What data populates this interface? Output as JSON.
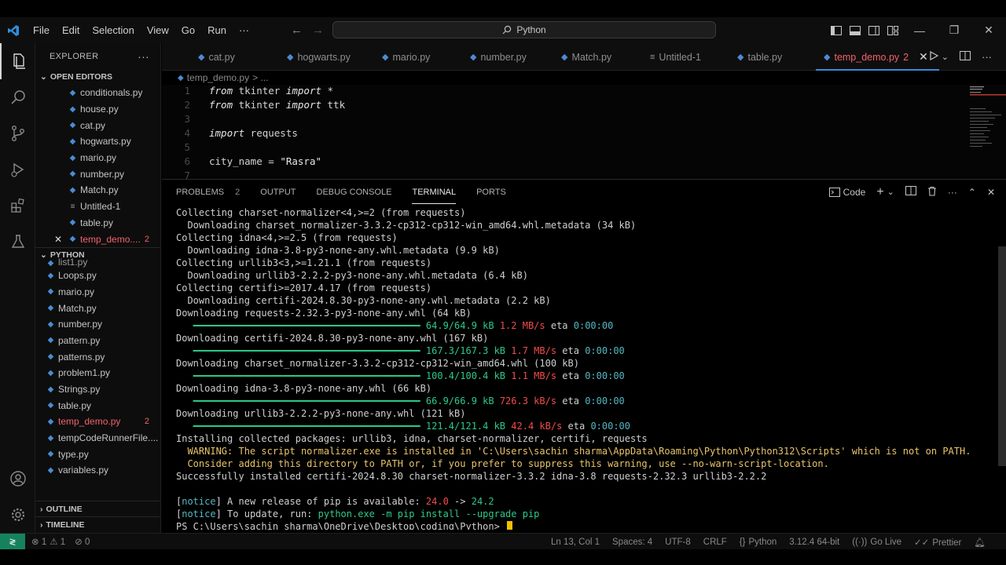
{
  "titlebar": {
    "menu": [
      "File",
      "Edit",
      "Selection",
      "View",
      "Go",
      "Run",
      "···"
    ],
    "search_text": "Python"
  },
  "explorer": {
    "title": "EXPLORER",
    "more": "···",
    "open_editors_label": "OPEN EDITORS",
    "open_editors": [
      {
        "name": "conditionals.py"
      },
      {
        "name": "house.py"
      },
      {
        "name": "cat.py"
      },
      {
        "name": "hogwarts.py"
      },
      {
        "name": "mario.py"
      },
      {
        "name": "number.py"
      },
      {
        "name": "Match.py"
      },
      {
        "name": "Untitled-1"
      },
      {
        "name": "table.py"
      },
      {
        "name": "temp_demo....",
        "badge": "2"
      }
    ],
    "folder_label": "PYTHON",
    "files": [
      {
        "name": "list1.py"
      },
      {
        "name": "Loops.py"
      },
      {
        "name": "mario.py"
      },
      {
        "name": "Match.py"
      },
      {
        "name": "number.py"
      },
      {
        "name": "pattern.py"
      },
      {
        "name": "patterns.py"
      },
      {
        "name": "problem1.py"
      },
      {
        "name": "Strings.py"
      },
      {
        "name": "table.py"
      },
      {
        "name": "temp_demo.py",
        "badge": "2"
      },
      {
        "name": "tempCodeRunnerFile...."
      },
      {
        "name": "type.py"
      },
      {
        "name": "variables.py"
      }
    ],
    "outline_label": "OUTLINE",
    "timeline_label": "TIMELINE"
  },
  "tabs": [
    {
      "label": "cat.py"
    },
    {
      "label": "hogwarts.py"
    },
    {
      "label": "mario.py"
    },
    {
      "label": "number.py"
    },
    {
      "label": "Match.py"
    },
    {
      "label": "Untitled-1"
    },
    {
      "label": "table.py"
    },
    {
      "label": "temp_demo.py",
      "badge": "2"
    }
  ],
  "breadcrumb": {
    "file": "temp_demo.py",
    "sep": "> ..."
  },
  "editor_lines": [
    {
      "n": "1",
      "parts": [
        [
          "kw",
          "from"
        ],
        [
          "",
          " tkinter "
        ],
        [
          "kw",
          "import"
        ],
        [
          "",
          " *"
        ]
      ]
    },
    {
      "n": "2",
      "parts": [
        [
          "kw",
          "from"
        ],
        [
          "",
          " tkinter "
        ],
        [
          "kw",
          "import"
        ],
        [
          "",
          " ttk"
        ]
      ]
    },
    {
      "n": "3",
      "parts": []
    },
    {
      "n": "4",
      "parts": [
        [
          "kw",
          "import"
        ],
        [
          "",
          " requests"
        ]
      ]
    },
    {
      "n": "5",
      "parts": []
    },
    {
      "n": "6",
      "parts": [
        [
          "",
          "city_name = "
        ],
        [
          "str",
          "\"Rasra\""
        ]
      ]
    },
    {
      "n": "7",
      "parts": []
    }
  ],
  "panel": {
    "tabs": {
      "problems": "PROBLEMS",
      "problems_count": "2",
      "output": "OUTPUT",
      "debug": "DEBUG CONSOLE",
      "terminal": "TERMINAL",
      "ports": "PORTS"
    },
    "terminal_profile": "Code"
  },
  "terminal_lines": [
    [
      [
        "",
        "Collecting charset-normalizer<4,>=2 (from requests)"
      ]
    ],
    [
      [
        "",
        "  Downloading charset_normalizer-3.3.2-cp312-cp312-win_amd64.whl.metadata (34 kB)"
      ]
    ],
    [
      [
        "",
        "Collecting idna<4,>=2.5 (from requests)"
      ]
    ],
    [
      [
        "",
        "  Downloading idna-3.8-py3-none-any.whl.metadata (9.9 kB)"
      ]
    ],
    [
      [
        "",
        "Collecting urllib3<3,>=1.21.1 (from requests)"
      ]
    ],
    [
      [
        "",
        "  Downloading urllib3-2.2.2-py3-none-any.whl.metadata (6.4 kB)"
      ]
    ],
    [
      [
        "",
        "Collecting certifi>=2017.4.17 (from requests)"
      ]
    ],
    [
      [
        "",
        "  Downloading certifi-2024.8.30-py3-none-any.whl.metadata (2.2 kB)"
      ]
    ],
    [
      [
        "",
        "Downloading requests-2.32.3-py3-none-any.whl (64 kB)"
      ]
    ],
    [
      [
        "bar",
        "   ━━━━━━━━━━━━━━━━━━━━━━━━━━━━━━━━━━━━━━━━ "
      ],
      [
        "green",
        "64.9/64.9 kB"
      ],
      [
        "",
        " "
      ],
      [
        "red",
        "1.2 MB/s"
      ],
      [
        "",
        " eta "
      ],
      [
        "cyan",
        "0:00:00"
      ]
    ],
    [
      [
        "",
        "Downloading certifi-2024.8.30-py3-none-any.whl (167 kB)"
      ]
    ],
    [
      [
        "bar",
        "   ━━━━━━━━━━━━━━━━━━━━━━━━━━━━━━━━━━━━━━━━ "
      ],
      [
        "green",
        "167.3/167.3 kB"
      ],
      [
        "",
        " "
      ],
      [
        "red",
        "1.7 MB/s"
      ],
      [
        "",
        " eta "
      ],
      [
        "cyan",
        "0:00:00"
      ]
    ],
    [
      [
        "",
        "Downloading charset_normalizer-3.3.2-cp312-cp312-win_amd64.whl (100 kB)"
      ]
    ],
    [
      [
        "bar",
        "   ━━━━━━━━━━━━━━━━━━━━━━━━━━━━━━━━━━━━━━━━ "
      ],
      [
        "green",
        "100.4/100.4 kB"
      ],
      [
        "",
        " "
      ],
      [
        "red",
        "1.1 MB/s"
      ],
      [
        "",
        " eta "
      ],
      [
        "cyan",
        "0:00:00"
      ]
    ],
    [
      [
        "",
        "Downloading idna-3.8-py3-none-any.whl (66 kB)"
      ]
    ],
    [
      [
        "bar",
        "   ━━━━━━━━━━━━━━━━━━━━━━━━━━━━━━━━━━━━━━━━ "
      ],
      [
        "green",
        "66.9/66.9 kB"
      ],
      [
        "",
        " "
      ],
      [
        "red",
        "726.3 kB/s"
      ],
      [
        "",
        " eta "
      ],
      [
        "cyan",
        "0:00:00"
      ]
    ],
    [
      [
        "",
        "Downloading urllib3-2.2.2-py3-none-any.whl (121 kB)"
      ]
    ],
    [
      [
        "bar",
        "   ━━━━━━━━━━━━━━━━━━━━━━━━━━━━━━━━━━━━━━━━ "
      ],
      [
        "green",
        "121.4/121.4 kB"
      ],
      [
        "",
        " "
      ],
      [
        "red",
        "42.4 kB/s"
      ],
      [
        "",
        " eta "
      ],
      [
        "cyan",
        "0:00:00"
      ]
    ],
    [
      [
        "",
        "Installing collected packages: urllib3, idna, charset-normalizer, certifi, requests"
      ]
    ],
    [
      [
        "warn",
        "  WARNING: The script normalizer.exe is installed in 'C:\\Users\\sachin sharma\\AppData\\Roaming\\Python\\Python312\\Scripts' which is not on PATH."
      ]
    ],
    [
      [
        "warn",
        "  Consider adding this directory to PATH or, if you prefer to suppress this warning, use --no-warn-script-location."
      ]
    ],
    [
      [
        "",
        "Successfully installed certifi-2024.8.30 charset-normalizer-3.3.2 idna-3.8 requests-2.32.3 urllib3-2.2.2"
      ]
    ],
    [
      [
        "",
        ""
      ]
    ],
    [
      [
        "",
        "["
      ],
      [
        "cyan",
        "notice"
      ],
      [
        "",
        "] A new release of pip is available: "
      ],
      [
        "red",
        "24.0"
      ],
      [
        "",
        " -> "
      ],
      [
        "green",
        "24.2"
      ]
    ],
    [
      [
        "",
        "["
      ],
      [
        "cyan",
        "notice"
      ],
      [
        "",
        "] To update, run: "
      ],
      [
        "green",
        "python.exe -m pip install --upgrade pip"
      ]
    ],
    [
      [
        "",
        "PS C:\\Users\\sachin sharma\\OneDrive\\Desktop\\coding\\Python> "
      ]
    ]
  ],
  "statusbar": {
    "errors": "⊗ 1",
    "warnings": "⚠ 1",
    "info": "⊘ 0",
    "position": "Ln 13, Col 1",
    "spaces": "Spaces: 4",
    "encoding": "UTF-8",
    "eol": "CRLF",
    "language": "Python",
    "interpreter": "3.12.4 64-bit",
    "golive": "Go Live",
    "prettier": "Prettier"
  },
  "colors": {
    "accent": "#3c8ad6",
    "error": "#f0626b",
    "remote": "#16825d",
    "cursor": "#f0c000"
  }
}
